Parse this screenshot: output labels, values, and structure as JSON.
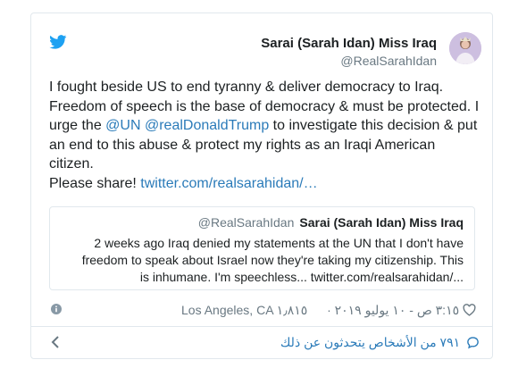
{
  "tweet": {
    "display_name": "Sarai (Sarah Idan) Miss Iraq",
    "handle": "@RealSarahIdan",
    "text_1": "I fought beside US to end tyranny & deliver democracy to Iraq. Freedom of speech is the base of democracy & must be protected. I urge the ",
    "mention_un": "@UN",
    "mention_trump": "@realDonaldTrump",
    "text_2": " to investigate this decision & put an end to this abuse & protect my rights as an Iraqi American citizen.",
    "text_3": "Please share! ",
    "link": "twitter.com/realsarahidan/…"
  },
  "quote": {
    "handle": "@RealSarahIdan",
    "display_name": "Sarai (Sarah Idan) Miss Iraq",
    "text": "2 weeks ago Iraq denied my statements at the UN that I don't have freedom to speak about Israel now they're taking my citizenship. This is inhumane. I'm speechless... twitter.com/realsarahidan/..."
  },
  "meta": {
    "location": "Los Angeles, CA",
    "datetime": "٣:١٥ ص - ١٠ يوليو ٢٠١٩ ·",
    "likes": "١٫٨١٥"
  },
  "footer": {
    "people_talking": "٧٩١ من الأشخاص يتحدثون عن ذلك"
  },
  "colors": {
    "link": "#2b7bb9",
    "twitter_blue": "#1da1f2",
    "muted": "#697882",
    "border": "#e1e8ed"
  }
}
